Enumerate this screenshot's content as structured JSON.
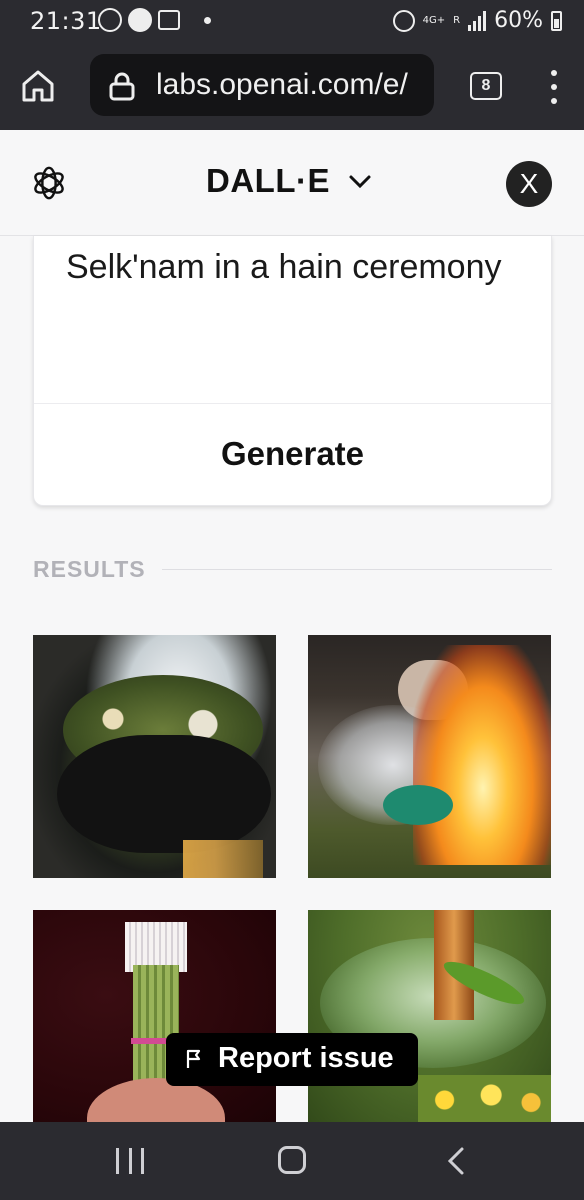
{
  "status_bar": {
    "time": "21:31",
    "network_top": "4G+",
    "network_bottom": "R",
    "battery": "60%"
  },
  "browser": {
    "url": "labs.openai.com/e/",
    "tab_count": "8"
  },
  "header": {
    "title": "DALL·E",
    "close_label": "X"
  },
  "prompt": {
    "text": "Selk'nam in a hain ceremony",
    "generate_label": "Generate"
  },
  "results": {
    "label": "RESULTS"
  },
  "report": {
    "label": "Report issue"
  }
}
